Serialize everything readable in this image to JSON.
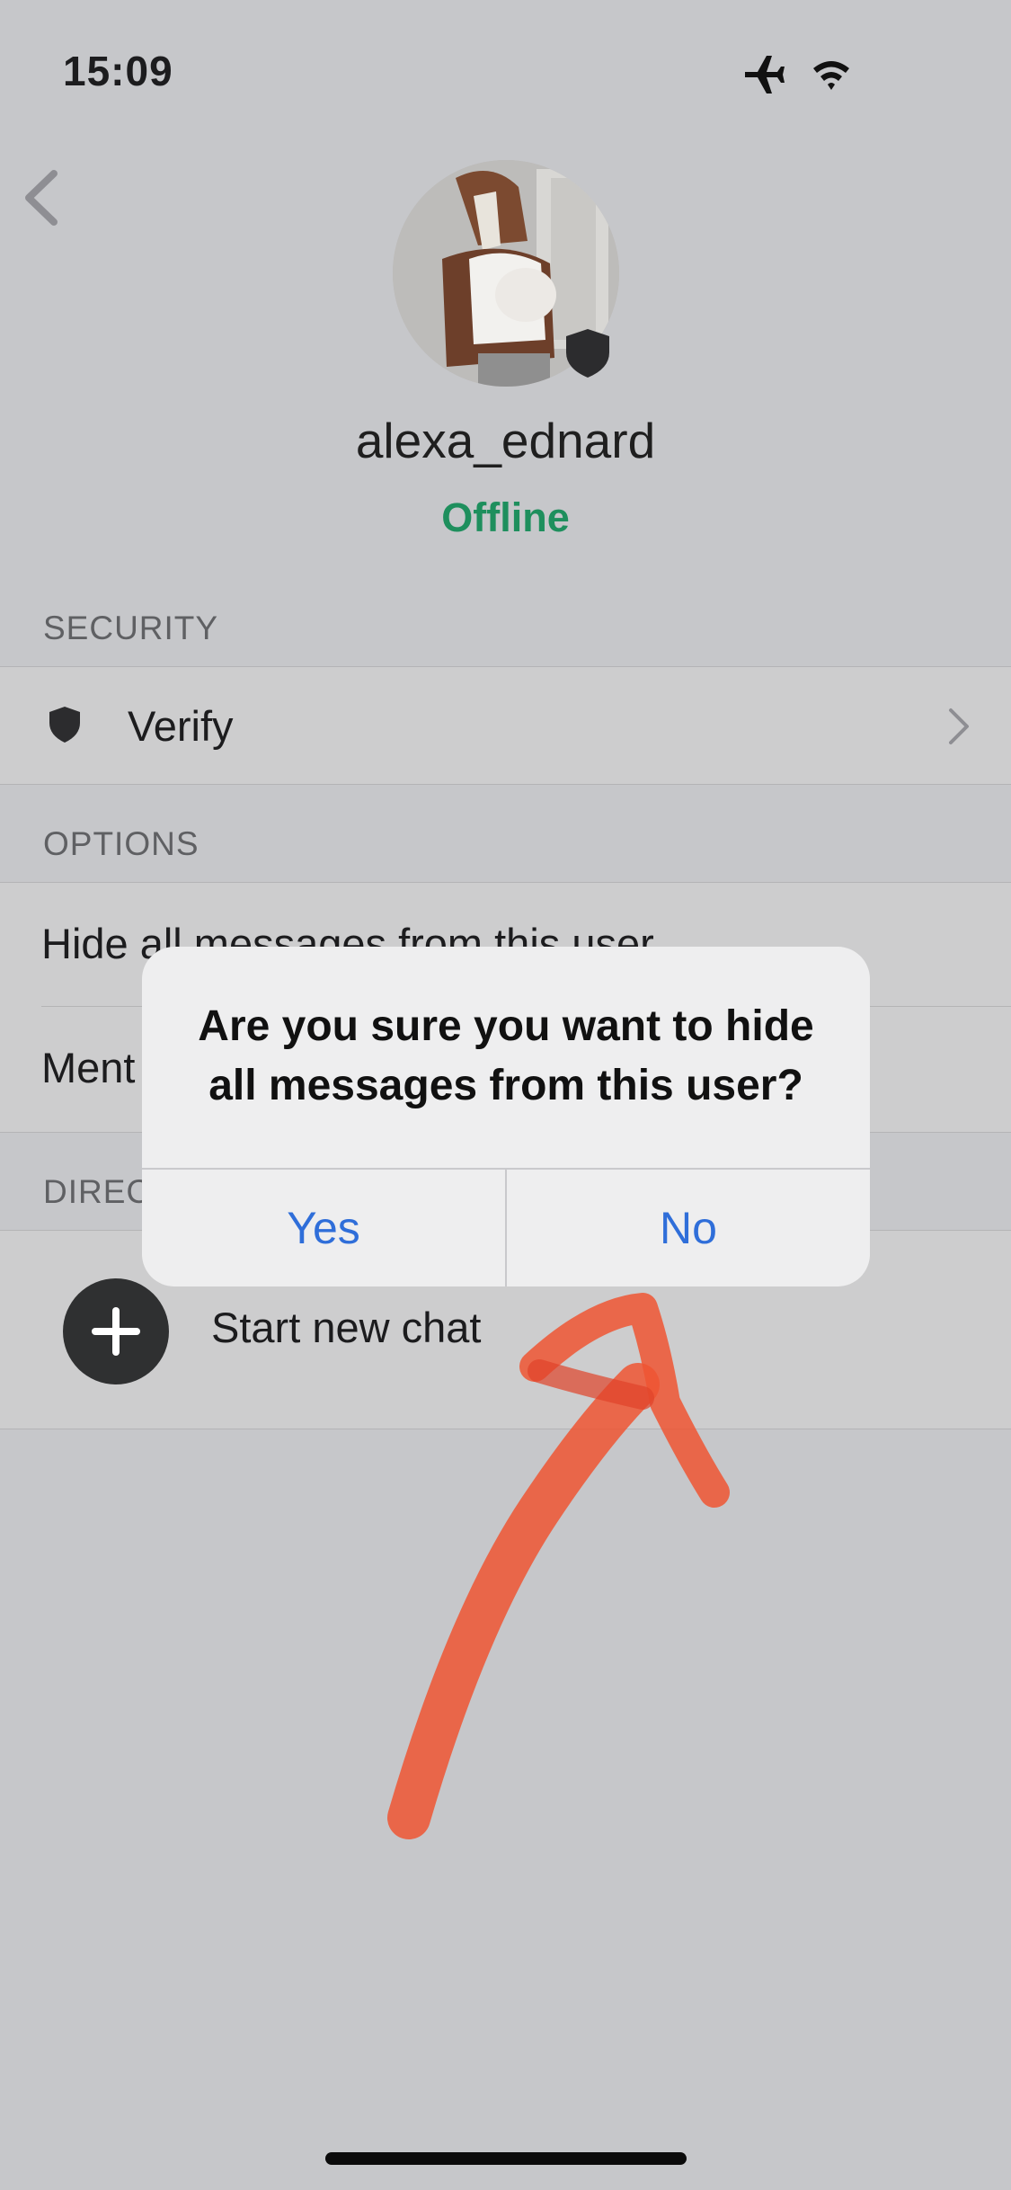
{
  "status_bar": {
    "time": "15:09",
    "icons": [
      "airplane-icon",
      "wifi-icon"
    ]
  },
  "profile": {
    "username": "alexa_ednard",
    "status": "Offline",
    "status_color": "#1e8f5d"
  },
  "sections": {
    "security": {
      "header": "SECURITY",
      "verify_label": "Verify"
    },
    "options": {
      "header": "OPTIONS",
      "hide_messages_label": "Hide all messages from this user",
      "mention_label": "Ment"
    },
    "direct": {
      "header": "DIREC",
      "start_chat_label": "Start new chat"
    }
  },
  "dialog": {
    "title": "Are you sure you want to hide all messages from this user?",
    "yes_label": "Yes",
    "no_label": "No",
    "button_color": "#2f6ed9"
  },
  "annotation": {
    "arrow_color": "#ee5532"
  }
}
